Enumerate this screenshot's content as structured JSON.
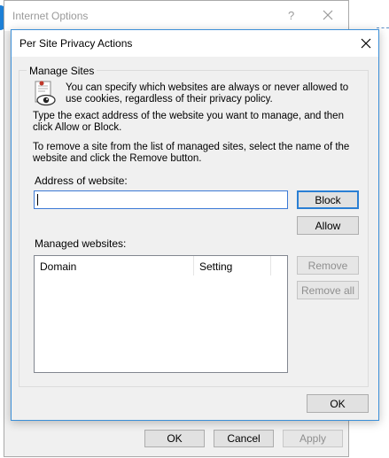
{
  "background_window": {
    "title": "Internet Options",
    "help_glyph": "?",
    "buttons": {
      "ok": "OK",
      "cancel": "Cancel",
      "apply": "Apply"
    }
  },
  "dialog": {
    "title": "Per Site Privacy Actions",
    "group_label": "Manage Sites",
    "intro": "You can specify which websites are always or never allowed to use cookies, regardless of their privacy policy.",
    "instructions_1": "Type the exact address of the website you want to manage, and then click Allow or Block.",
    "instructions_2": "To remove a site from the list of managed sites, select the name of the website and click the Remove button.",
    "address_label": "Address of website:",
    "address_value": "",
    "managed_label": "Managed websites:",
    "columns": {
      "domain": "Domain",
      "setting": "Setting"
    },
    "buttons": {
      "block": "Block",
      "allow": "Allow",
      "remove": "Remove",
      "remove_all": "Remove all",
      "ok": "OK"
    }
  },
  "colors": {
    "accent": "#3b8fd8",
    "window_bg": "#f0f0f0",
    "disabled_text": "#8f8f8f"
  },
  "icons": [
    "close-icon",
    "help-icon",
    "privacy-eye-icon"
  ]
}
